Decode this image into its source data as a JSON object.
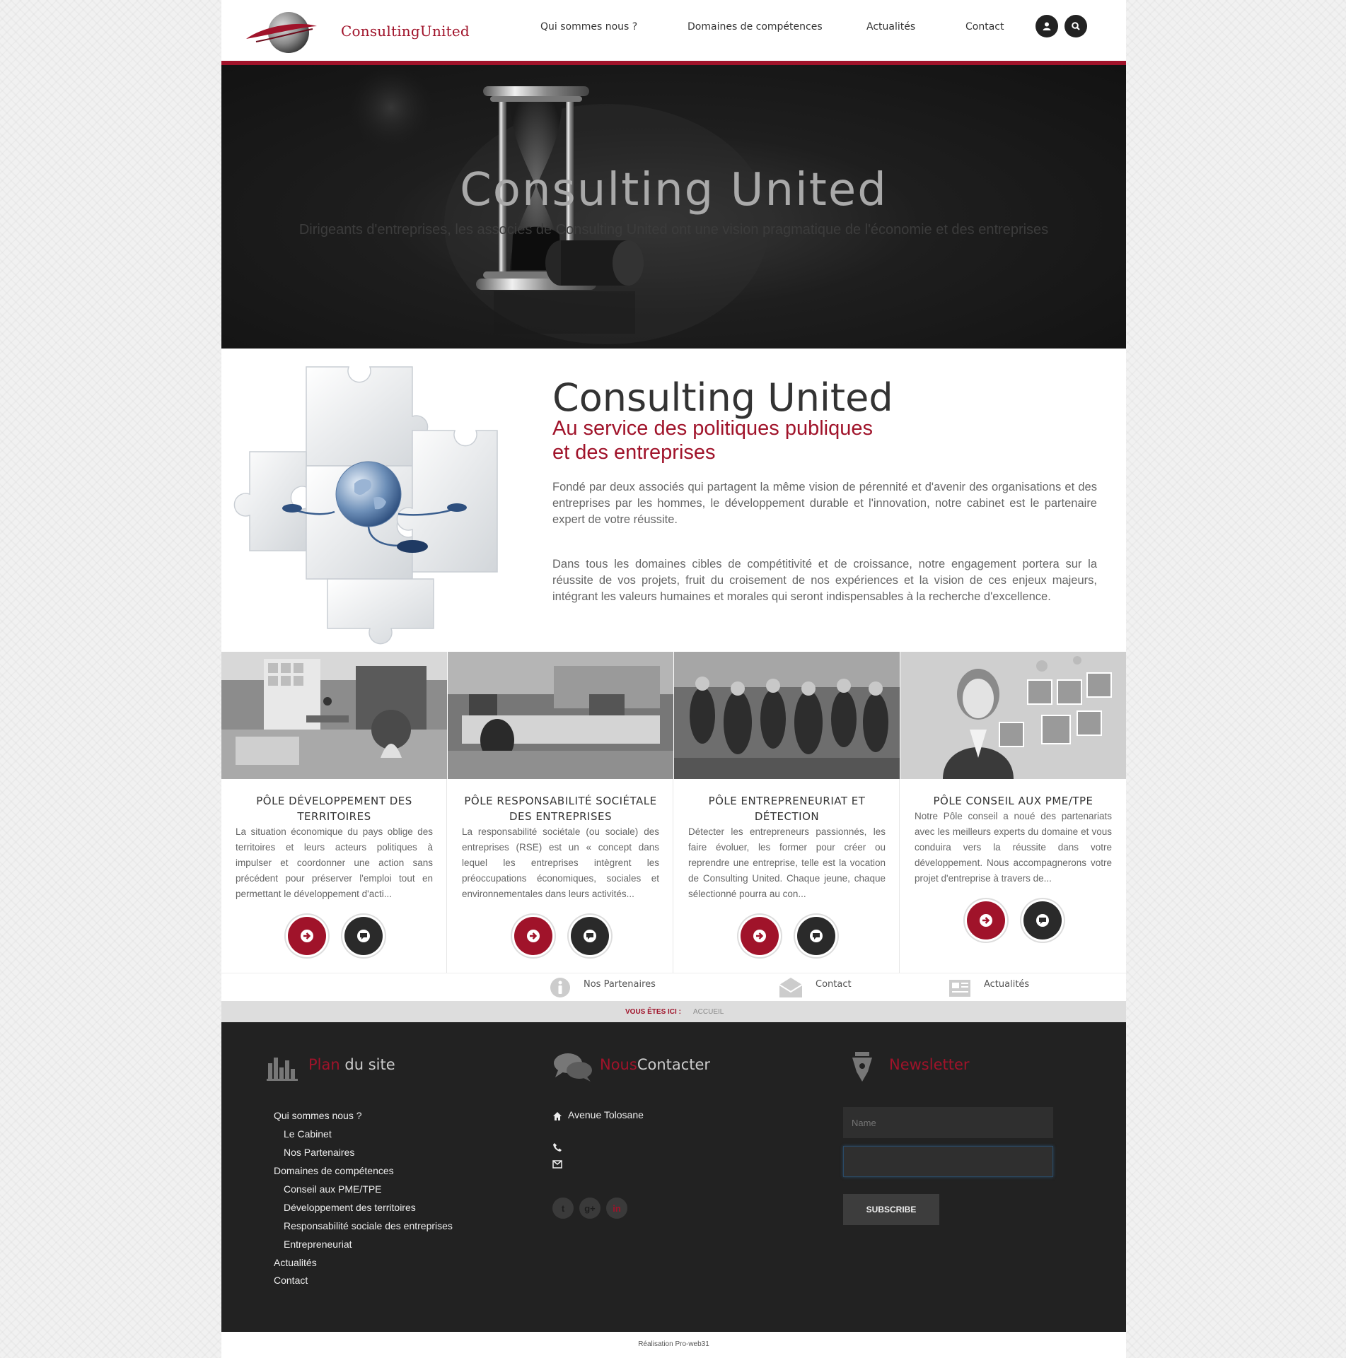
{
  "brand": {
    "name": "ConsultingUnited"
  },
  "nav": {
    "items": [
      {
        "label": "Qui sommes nous ?"
      },
      {
        "label": "Domaines de compétences"
      },
      {
        "label": "Actualités"
      },
      {
        "label": "Contact"
      }
    ]
  },
  "hero": {
    "title": "Consulting United",
    "subtitle": "Dirigeants d'entreprises, les associés de Consulting United ont une vision pragmatique de l'économie et des entreprises"
  },
  "intro": {
    "title": "Consulting United",
    "subtitle_line1": "Au service des politiques publiques",
    "subtitle_line2": "et des entreprises",
    "paragraph1": "Fondé par deux associés qui partagent la même vision de pérennité et d'avenir des organisations et des entreprises par les hommes, le développement durable et l'innovation, notre cabinet est le partenaire expert de votre réussite.",
    "paragraph2": "Dans tous les domaines cibles de compétitivité et de croissance, notre engagement portera sur la réussite de vos projets, fruit du croisement de nos expériences et la vision de ces enjeux majeurs, intégrant les valeurs humaines et morales qui seront indispensables à la recherche d'excellence."
  },
  "poles": [
    {
      "title": "Pôle développement des territoires",
      "text": "La situation économique du pays oblige des territoires et leurs acteurs politiques à impulser et coordonner une action sans précédent pour préserver l'emploi tout en permettant le développement d'acti..."
    },
    {
      "title": "Pôle responsabilité sociétale des entreprises",
      "text": "La responsabilité sociétale (ou sociale) des entreprises (RSE) est un « concept dans lequel les entreprises intègrent les préoccupations économiques, sociales et environnementales dans leurs activités..."
    },
    {
      "title": "Pôle entrepreneuriat et détection",
      "text": "Détecter les entrepreneurs passionnés, les faire évoluer, les former pour créer ou reprendre une entreprise, telle est la vocation de Consulting United. Chaque jeune, chaque sélectionné pourra au con..."
    },
    {
      "title": "Pôle conseil aux PME/TPE",
      "text": "Notre Pôle conseil a noué des partenariats avec les meilleurs experts du domaine et vous conduira vers la réussite dans votre développement. Nous accompagnerons votre projet d'entreprise à travers de..."
    }
  ],
  "sublinks": [
    {
      "label": "Nos Partenaires",
      "icon": "info-icon"
    },
    {
      "label": "Contact",
      "icon": "envelope-icon"
    },
    {
      "label": "Actualités",
      "icon": "newspaper-icon"
    }
  ],
  "breadcrumb": {
    "label": "VOUS ÊTES ICI :",
    "current": "ACCUEIL"
  },
  "footer": {
    "sitemap": {
      "title_red": "Plan",
      "title_rest": "du site",
      "links": [
        {
          "label": "Qui sommes nous ?"
        },
        {
          "label": "Le Cabinet"
        },
        {
          "label": "Nos Partenaires"
        },
        {
          "label": "Domaines de compétences"
        },
        {
          "label": "Conseil aux PME/TPE"
        },
        {
          "label": "Développement des territoires"
        },
        {
          "label": "Responsabilité sociale des entreprises"
        },
        {
          "label": "Entrepreneuriat"
        },
        {
          "label": "Actualités"
        },
        {
          "label": "Contact"
        }
      ]
    },
    "contact": {
      "title_red": "Nous",
      "title_rest": "Contacter",
      "address": "Avenue Tolosane"
    },
    "newsletter": {
      "title": "Newsletter",
      "name_placeholder": "Name",
      "subscribe_label": "SUBSCRIBE"
    },
    "social": [
      {
        "icon": "twitter-icon",
        "glyph": "t"
      },
      {
        "icon": "google-plus-icon",
        "glyph": "g+"
      },
      {
        "icon": "linkedin-icon",
        "glyph": "in"
      }
    ]
  },
  "credits": "Réalisation Pro-web31",
  "colors": {
    "accent": "#a0132a",
    "dark": "#222222"
  }
}
